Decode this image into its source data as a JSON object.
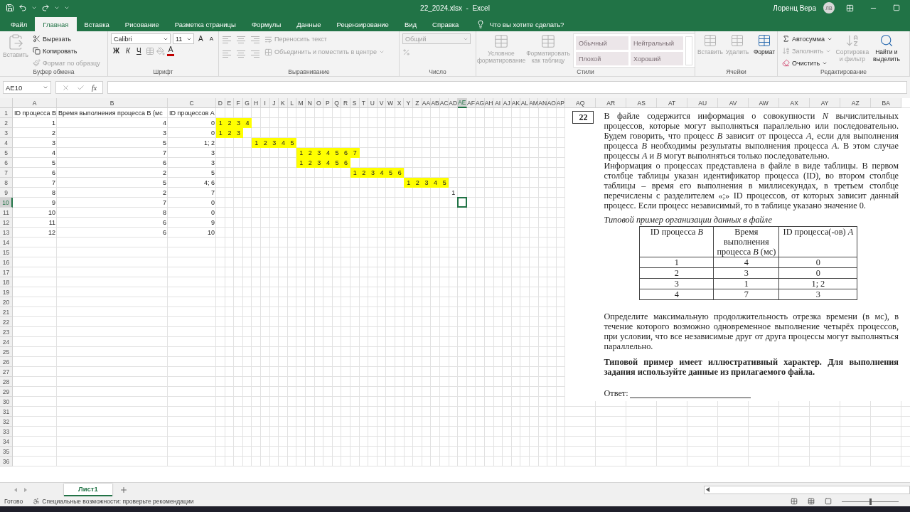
{
  "title_bar": {
    "title": "22_2024.xlsx  -  Excel",
    "user": "Лоренц Вера",
    "avatar": "ЛВ"
  },
  "tabs": [
    {
      "label": "Файл",
      "selected": false
    },
    {
      "label": "Главная",
      "selected": true
    },
    {
      "label": "Вставка",
      "selected": false
    },
    {
      "label": "Рисование",
      "selected": false
    },
    {
      "label": "Разметка страницы",
      "selected": false
    },
    {
      "label": "Формулы",
      "selected": false
    },
    {
      "label": "Данные",
      "selected": false
    },
    {
      "label": "Рецензирование",
      "selected": false
    },
    {
      "label": "Вид",
      "selected": false
    },
    {
      "label": "Справка",
      "selected": false
    }
  ],
  "tell_me": "Что вы хотите сделать?",
  "ribbon": {
    "clipboard": {
      "label": "Буфер обмена",
      "paste": {
        "label": "Вставить",
        "disabled": true
      },
      "items": [
        {
          "label": "Вырезать",
          "disabled": false
        },
        {
          "label": "Копировать",
          "disabled": false
        },
        {
          "label": "Формат по образцу",
          "disabled": true
        }
      ]
    },
    "font": {
      "label": "Шрифт",
      "name": "Calibri",
      "size": "11",
      "grow": "A",
      "shrink": "A",
      "bold": "Ж",
      "italic": "К",
      "underline": "Ч",
      "font_color_label": "A"
    },
    "alignment": {
      "label": "Выравнивание",
      "wrap": {
        "label": "Переносить текст",
        "disabled": true
      },
      "merge": {
        "label": "Объединить и поместить в центре",
        "disabled": true
      }
    },
    "number": {
      "label": "Число",
      "format": "Общий",
      "disabled": true
    },
    "styles": {
      "label": "Стили",
      "buttons": [
        {
          "label": "Условное форматирование",
          "disabled": true
        },
        {
          "label": "Форматировать как таблицу",
          "disabled": true
        }
      ],
      "cells": [
        "Обычный",
        "Нейтральный",
        "Плохой",
        "Хороший"
      ]
    },
    "cells": {
      "label": "Ячейки",
      "buttons": [
        {
          "label": "Вставить",
          "disabled": true
        },
        {
          "label": "Удалить",
          "disabled": true
        },
        {
          "label": "Формат",
          "disabled": false
        }
      ]
    },
    "editing": {
      "label": "Редактирование",
      "items": [
        {
          "label": "Автосумма",
          "disabled": false
        },
        {
          "label": "Заполнить",
          "disabled": true
        },
        {
          "label": "Очистить",
          "disabled": false
        }
      ],
      "buttons": [
        {
          "label": "Сортировка и фильтр",
          "disabled": true
        },
        {
          "label": "Найти и выделить",
          "disabled": false
        }
      ]
    }
  },
  "formula_bar": {
    "name_box": "AE10",
    "function_label": "fx"
  },
  "sheet": {
    "columns": [
      {
        "label": "A",
        "selected": false
      },
      {
        "label": "B",
        "selected": false
      },
      {
        "label": "C",
        "selected": false
      },
      {
        "label": "D",
        "selected": false
      },
      {
        "label": "E",
        "selected": false
      },
      {
        "label": "F",
        "selected": false
      },
      {
        "label": "G",
        "selected": false
      },
      {
        "label": "H",
        "selected": false
      },
      {
        "label": "I",
        "selected": false
      },
      {
        "label": "J",
        "selected": false
      },
      {
        "label": "K",
        "selected": false
      },
      {
        "label": "L",
        "selected": false
      },
      {
        "label": "M",
        "selected": false
      },
      {
        "label": "N",
        "selected": false
      },
      {
        "label": "O",
        "selected": false
      },
      {
        "label": "P",
        "selected": false
      },
      {
        "label": "Q",
        "selected": false
      },
      {
        "label": "R",
        "selected": false
      },
      {
        "label": "S",
        "selected": false
      },
      {
        "label": "T",
        "selected": false
      },
      {
        "label": "U",
        "selected": false
      },
      {
        "label": "V",
        "selected": false
      },
      {
        "label": "W",
        "selected": false
      },
      {
        "label": "X",
        "selected": false
      },
      {
        "label": "Y",
        "selected": false
      },
      {
        "label": "Z",
        "selected": false
      },
      {
        "label": "AA",
        "selected": false
      },
      {
        "label": "AB",
        "selected": false
      },
      {
        "label": "AC",
        "selected": false
      },
      {
        "label": "AD",
        "selected": false
      },
      {
        "label": "AE",
        "selected": true
      },
      {
        "label": "AF",
        "selected": false
      },
      {
        "label": "AG",
        "selected": false
      },
      {
        "label": "AH",
        "selected": false
      },
      {
        "label": "AI",
        "selected": false
      },
      {
        "label": "AJ",
        "selected": false
      },
      {
        "label": "AK",
        "selected": false
      },
      {
        "label": "AL",
        "selected": false
      },
      {
        "label": "AM",
        "selected": false
      },
      {
        "label": "AN",
        "selected": false
      },
      {
        "label": "AO",
        "selected": false
      },
      {
        "label": "AP",
        "selected": false
      },
      {
        "label": "AQ",
        "selected": false
      },
      {
        "label": "AR",
        "selected": false
      },
      {
        "label": "AS",
        "selected": false
      },
      {
        "label": "AT",
        "selected": false
      },
      {
        "label": "AU",
        "selected": false
      },
      {
        "label": "AV",
        "selected": false
      },
      {
        "label": "AW",
        "selected": false
      },
      {
        "label": "AX",
        "selected": false
      },
      {
        "label": "AY",
        "selected": false
      },
      {
        "label": "AZ",
        "selected": false
      },
      {
        "label": "BA",
        "selected": false
      }
    ],
    "rows": [
      {
        "number": "1",
        "selected": false,
        "kind": "header",
        "cells": [
          "ID процесса B",
          "Время выполнения процесса B (мс",
          "ID процессов A"
        ]
      },
      {
        "number": "2",
        "selected": false,
        "kind": "data",
        "cells": [
          "1",
          "4",
          "0"
        ],
        "gantt": {
          "D": {
            "text": "1",
            "filled": true
          },
          "E": {
            "text": "2",
            "filled": true
          },
          "F": {
            "text": "3",
            "filled": true
          },
          "G": {
            "text": "4",
            "filled": true
          }
        }
      },
      {
        "number": "3",
        "selected": false,
        "kind": "data",
        "cells": [
          "2",
          "3",
          "0"
        ],
        "gantt": {
          "D": {
            "text": "1",
            "filled": true
          },
          "E": {
            "text": "2",
            "filled": true
          },
          "F": {
            "text": "3",
            "filled": true
          }
        }
      },
      {
        "number": "4",
        "selected": false,
        "kind": "data",
        "cells": [
          "3",
          "5",
          "1; 2"
        ],
        "gantt": {
          "H": {
            "text": "1",
            "filled": true
          },
          "I": {
            "text": "2",
            "filled": true
          },
          "J": {
            "text": "3",
            "filled": true
          },
          "K": {
            "text": "4",
            "filled": true
          },
          "L": {
            "text": "5",
            "filled": true
          }
        }
      },
      {
        "number": "5",
        "selected": false,
        "kind": "data",
        "cells": [
          "4",
          "7",
          "3"
        ],
        "gantt": {
          "M": {
            "text": "1",
            "filled": true
          },
          "N": {
            "text": "2",
            "filled": true
          },
          "O": {
            "text": "3",
            "filled": true
          },
          "P": {
            "text": "4",
            "filled": true
          },
          "Q": {
            "text": "5",
            "filled": true
          },
          "R": {
            "text": "6",
            "filled": true
          },
          "S": {
            "text": "7",
            "filled": true
          }
        }
      },
      {
        "number": "6",
        "selected": false,
        "kind": "data",
        "cells": [
          "5",
          "6",
          "3"
        ],
        "gantt": {
          "M": {
            "text": "1",
            "filled": true
          },
          "N": {
            "text": "2",
            "filled": true
          },
          "O": {
            "text": "3",
            "filled": true
          },
          "P": {
            "text": "4",
            "filled": true
          },
          "Q": {
            "text": "5",
            "filled": true
          },
          "R": {
            "text": "6",
            "filled": true
          }
        }
      },
      {
        "number": "7",
        "selected": false,
        "kind": "data",
        "cells": [
          "6",
          "2",
          "5"
        ],
        "gantt": {
          "S": {
            "text": "1",
            "filled": true
          },
          "T": {
            "text": "2",
            "filled": true
          },
          "U": {
            "text": "3",
            "filled": true
          },
          "V": {
            "text": "4",
            "filled": true
          },
          "W": {
            "text": "5",
            "filled": true
          },
          "X": {
            "text": "6",
            "filled": true
          }
        }
      },
      {
        "number": "8",
        "selected": false,
        "kind": "data",
        "cells": [
          "7",
          "5",
          "4; 6"
        ],
        "gantt": {
          "Y": {
            "text": "1",
            "filled": true
          },
          "Z": {
            "text": "2",
            "filled": true
          },
          "AA": {
            "text": "3",
            "filled": true
          },
          "AB": {
            "text": "4",
            "filled": true
          },
          "AC": {
            "text": "5",
            "filled": true
          }
        }
      },
      {
        "number": "9",
        "selected": false,
        "kind": "data",
        "cells": [
          "8",
          "2",
          "7"
        ],
        "gantt": {
          "AD": {
            "text": "1",
            "filled": false
          }
        }
      },
      {
        "number": "10",
        "selected": true,
        "kind": "data",
        "cells": [
          "9",
          "7",
          "0"
        ]
      },
      {
        "number": "11",
        "selected": false,
        "kind": "data",
        "cells": [
          "10",
          "8",
          "0"
        ]
      },
      {
        "number": "12",
        "selected": false,
        "kind": "data",
        "cells": [
          "11",
          "6",
          "9"
        ]
      },
      {
        "number": "13",
        "selected": false,
        "kind": "data",
        "cells": [
          "12",
          "6",
          "10"
        ]
      },
      {
        "number": "14",
        "selected": false,
        "kind": "blank"
      },
      {
        "number": "15",
        "selected": false,
        "kind": "blank"
      },
      {
        "number": "16",
        "selected": false,
        "kind": "blank"
      },
      {
        "number": "17",
        "selected": false,
        "kind": "blank"
      },
      {
        "number": "18",
        "selected": false,
        "kind": "blank"
      },
      {
        "number": "19",
        "selected": false,
        "kind": "blank"
      },
      {
        "number": "20",
        "selected": false,
        "kind": "blank"
      },
      {
        "number": "21",
        "selected": false,
        "kind": "blank"
      },
      {
        "number": "22",
        "selected": false,
        "kind": "blank"
      },
      {
        "number": "23",
        "selected": false,
        "kind": "blank"
      },
      {
        "number": "24",
        "selected": false,
        "kind": "blank"
      },
      {
        "number": "25",
        "selected": false,
        "kind": "blank"
      },
      {
        "number": "26",
        "selected": false,
        "kind": "blank"
      },
      {
        "number": "27",
        "selected": false,
        "kind": "blank"
      },
      {
        "number": "28",
        "selected": false,
        "kind": "blank"
      },
      {
        "number": "29",
        "selected": false,
        "kind": "blank"
      },
      {
        "number": "30",
        "selected": false,
        "kind": "blank"
      },
      {
        "number": "31",
        "selected": false,
        "kind": "blank"
      },
      {
        "number": "32",
        "selected": false,
        "kind": "blank"
      },
      {
        "number": "33",
        "selected": false,
        "kind": "blank"
      },
      {
        "number": "34",
        "selected": false,
        "kind": "blank"
      },
      {
        "number": "35",
        "selected": false,
        "kind": "blank"
      },
      {
        "number": "36",
        "selected": false,
        "kind": "blank"
      }
    ],
    "document": {
      "number": "22",
      "paragraphs": [
        "В файле содержится информация о совокупности *N* вычислительных процессов, которые могут выполняться параллельно или последовательно. Будем говорить, что процесс *B* зависит от процесса *A*, если для выполнения процесса *B* необходимы результаты выполнения процесса *A*. В этом случае процессы *A* и *B* могут выполняться только последовательно.",
        "Информация о процессах представлена в файле в виде таблицы. В первом столбце таблицы указан идентификатор процесса (ID), во втором столбце таблицы – время его выполнения в миллисекундах, в третьем столбце перечислены с разделителем «;» ID процессов, от которых зависит данный процесс. Если процесс независимый, то в таблице указано значение 0."
      ],
      "caption": "Типовой пример организации данных в файле",
      "table": {
        "columns": [
          "ID процесса *B*",
          "Время выполнения процесса *B* (мс)",
          "ID процесса(-ов) *A*"
        ],
        "rows": [
          [
            "1",
            "4",
            "0"
          ],
          [
            "2",
            "3",
            "0"
          ],
          [
            "3",
            "1",
            "1; 2"
          ],
          [
            "4",
            "7",
            "3"
          ]
        ]
      },
      "question": "Определите максимальную продолжительность отрезка времени (в мс), в течение которого возможно одновременное выполнение четырёх процессов, при условии, что все независимые друг от друга процессы могут выполняться параллельно.",
      "note": "Типовой пример имеет иллюстративный характер. Для выполнения задания используйте данные из прилагаемого файла.",
      "answer_label": "Ответ:"
    }
  },
  "sheet_tabs": [
    {
      "label": "Лист1",
      "selected": true
    }
  ],
  "status_bar": {
    "status": "Готово",
    "accessibility": "Специальные возможности: проверьте рекомендации",
    "zoom": {
      "level": 0.5
    }
  }
}
